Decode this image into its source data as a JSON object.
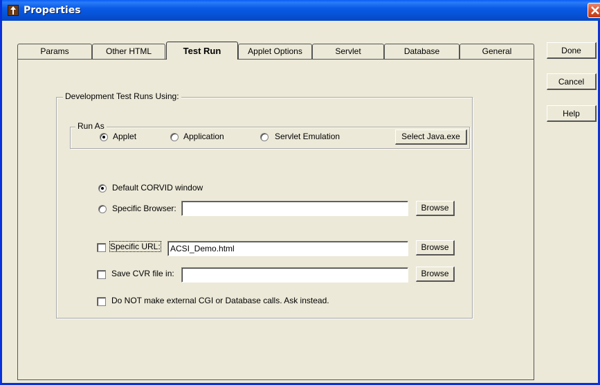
{
  "window": {
    "title": "Properties"
  },
  "tabs": [
    {
      "label": "Params"
    },
    {
      "label": "Other HTML"
    },
    {
      "label": "Test Run"
    },
    {
      "label": "Applet Options"
    },
    {
      "label": "Servlet"
    },
    {
      "label": "Database"
    },
    {
      "label": "General"
    }
  ],
  "active_tab": "Test Run",
  "side_buttons": {
    "done": "Done",
    "cancel": "Cancel",
    "help": "Help"
  },
  "dev_group": {
    "label": "Development Test Runs Using:"
  },
  "run_as": {
    "label": "Run As",
    "options": [
      "Applet",
      "Application",
      "Servlet Emulation"
    ],
    "selected": "Applet",
    "select_java_button": "Select Java.exe"
  },
  "window_options": {
    "default_label": "Default CORVID window",
    "default_selected": true,
    "browser_label": "Specific Browser:",
    "browser_value": ""
  },
  "specific_url": {
    "label": "Specific URL:",
    "checked": false,
    "value": "ACSI_Demo.html"
  },
  "save_cvr": {
    "label": "Save CVR file in:",
    "checked": false,
    "value": ""
  },
  "no_external": {
    "label": "Do NOT make external CGI or Database calls.  Ask instead.",
    "checked": false
  },
  "browse_label": "Browse"
}
